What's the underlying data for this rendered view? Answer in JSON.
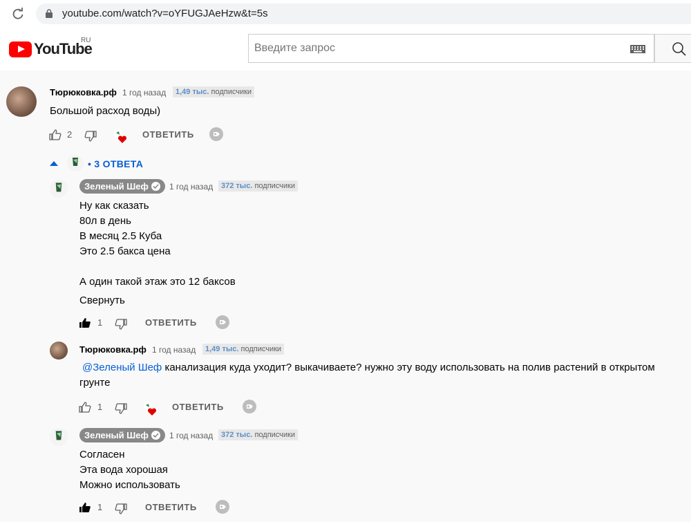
{
  "browser": {
    "url": "youtube.com/watch?v=oYFUGJAeHzw&t=5s"
  },
  "header": {
    "logo_text": "YouTube",
    "region": "RU",
    "search_placeholder": "Введите запрос"
  },
  "comments": [
    {
      "author": "Тюрюковка.рф",
      "time": "1 год назад",
      "subs_count": "1,49 тыс.",
      "subs_label": "подписчики",
      "text": "Большой расход воды)",
      "likes": "2",
      "reply_label": "ОТВЕТИТЬ"
    }
  ],
  "replies_toggle": {
    "label": "• 3 ОТВЕТА"
  },
  "replies": [
    {
      "author": "Зеленый Шеф",
      "time": "1 год назад",
      "subs_count": "372 тыс.",
      "subs_label": "подписчики",
      "lines": [
        "Ну как сказать",
        "80л в день",
        "В месяц 2.5 Куба",
        "Это 2.5 бакса цена",
        "",
        "А один такой этаж  это 12 баксов"
      ],
      "collapse_label": "Свернуть",
      "likes": "1",
      "reply_label": "ОТВЕТИТЬ"
    },
    {
      "author": "Тюрюковка.рф",
      "time": "1 год назад",
      "subs_count": "1,49 тыс.",
      "subs_label": "подписчики",
      "mention": "@Зеленый Шеф",
      "text": "  канализация куда уходит? выкачиваете? нужно эту воду использовать на полив растений в открытом",
      "text2": "грунте",
      "likes": "1",
      "reply_label": "ОТВЕТИТЬ"
    },
    {
      "author": "Зеленый Шеф",
      "time": "1 год назад",
      "subs_count": "372 тыс.",
      "subs_label": "подписчики",
      "lines": [
        "Согласен",
        "Эта вода хорошая",
        "Можно использовать"
      ],
      "likes": "1",
      "reply_label": "ОТВЕТИТЬ"
    }
  ]
}
